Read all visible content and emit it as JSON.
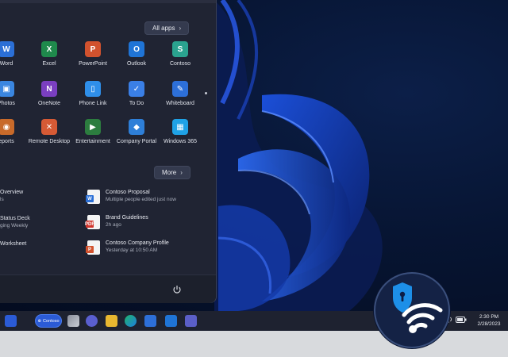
{
  "start_menu": {
    "all_apps_label": "All apps",
    "more_label": "More",
    "pinned": [
      {
        "label": "Word",
        "icon": "word-icon",
        "color": "#2b6fd6",
        "glyph": "W"
      },
      {
        "label": "Excel",
        "icon": "excel-icon",
        "color": "#1f8a4c",
        "glyph": "X"
      },
      {
        "label": "PowerPoint",
        "icon": "powerpoint-icon",
        "color": "#d2522e",
        "glyph": "P"
      },
      {
        "label": "Outlook",
        "icon": "outlook-icon",
        "color": "#1f74d6",
        "glyph": "O"
      },
      {
        "label": "Contoso",
        "icon": "contoso-icon",
        "color": "#2aa38f",
        "glyph": "S"
      },
      {
        "label": "Photos",
        "icon": "photos-icon",
        "color": "#3a86e0",
        "glyph": "▣"
      },
      {
        "label": "OneNote",
        "icon": "onenote-icon",
        "color": "#7a3fc0",
        "glyph": "N"
      },
      {
        "label": "Phone Link",
        "icon": "phone-link-icon",
        "color": "#2f8fea",
        "glyph": "▯"
      },
      {
        "label": "To Do",
        "icon": "todo-icon",
        "color": "#3a7fe6",
        "glyph": "✓"
      },
      {
        "label": "Whiteboard",
        "icon": "whiteboard-icon",
        "color": "#2d6fd8",
        "glyph": "✎"
      },
      {
        "label": "Reports",
        "icon": "reports-icon",
        "color": "#c86a2a",
        "glyph": "◉"
      },
      {
        "label": "Remote Desktop",
        "icon": "remote-desktop-icon",
        "color": "#d65a35",
        "glyph": "✕"
      },
      {
        "label": "Entertainment",
        "icon": "entertainment-icon",
        "color": "#2c7d3f",
        "glyph": "▶"
      },
      {
        "label": "Company Portal",
        "icon": "company-portal-icon",
        "color": "#2e7fd8",
        "glyph": "◆"
      },
      {
        "label": "Windows 365",
        "icon": "windows-365-icon",
        "color": "#1fa2e6",
        "glyph": "▦"
      }
    ],
    "pinned_visible_labels": [
      "Word",
      "Excel",
      "PowerPoint",
      "Outlook",
      "Contoso",
      "Photos",
      "OneNote",
      "Phone Link",
      "To Do",
      "Whiteboard",
      "eports",
      "Remote Desktop",
      "Entertainment",
      "Company Portal",
      "Windows 365"
    ],
    "recommended_left": [
      {
        "title": "Overview",
        "subtitle": "ls"
      },
      {
        "title": "Status Deck",
        "subtitle": "ging Weekly"
      },
      {
        "title": "Worksheet",
        "subtitle": ""
      }
    ],
    "recommended_right": [
      {
        "title": "Contoso Proposal",
        "subtitle": "Multiple people edited just now",
        "icon": "word-doc-icon",
        "tag": "W",
        "color": "#2b6fd6"
      },
      {
        "title": "Brand Guidelines",
        "subtitle": "2h ago",
        "icon": "pdf-doc-icon",
        "tag": "PDF",
        "color": "#d0352c"
      },
      {
        "title": "Contoso Company Profile",
        "subtitle": "Yesterday at 10:50 AM",
        "icon": "ppt-doc-icon",
        "tag": "P",
        "color": "#d2522e"
      }
    ]
  },
  "taskbar": {
    "search_label": "Contoso",
    "time": "2:30 PM",
    "date": "2/28/2023"
  }
}
